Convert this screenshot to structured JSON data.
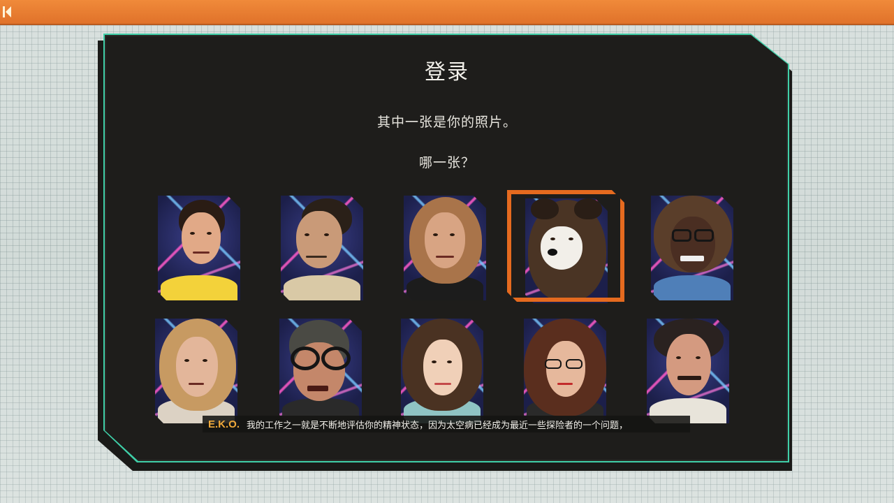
{
  "screen": {
    "title": "登录",
    "prompt_line1": "其中一张是你的照片。",
    "prompt_line2": "哪一张？"
  },
  "topbar": {
    "back_icon": "rewind-icon"
  },
  "portraits": [
    {
      "id": "boy-yellow-shirt",
      "selected": false
    },
    {
      "id": "man-smirk",
      "selected": false
    },
    {
      "id": "man-mullet",
      "selected": false
    },
    {
      "id": "dog",
      "selected": true
    },
    {
      "id": "man-glasses-wild-hair",
      "selected": false
    },
    {
      "id": "woman-blonde",
      "selected": false
    },
    {
      "id": "man-goggles-helmet",
      "selected": false
    },
    {
      "id": "woman-curly",
      "selected": false
    },
    {
      "id": "woman-big-hair-glasses",
      "selected": false
    },
    {
      "id": "man-mustache",
      "selected": false
    }
  ],
  "subtitle": {
    "speaker": "E.K.O.",
    "text": "我的工作之一就是不断地评估你的精神状态，因为太空病已经成为最近一些探险者的一个问题，"
  },
  "colors": {
    "accent_orange": "#e56a1f",
    "topbar_orange": "#f08a3a",
    "panel_edge_teal": "#3fcfa8",
    "speaker_gold": "#f0a93a"
  }
}
